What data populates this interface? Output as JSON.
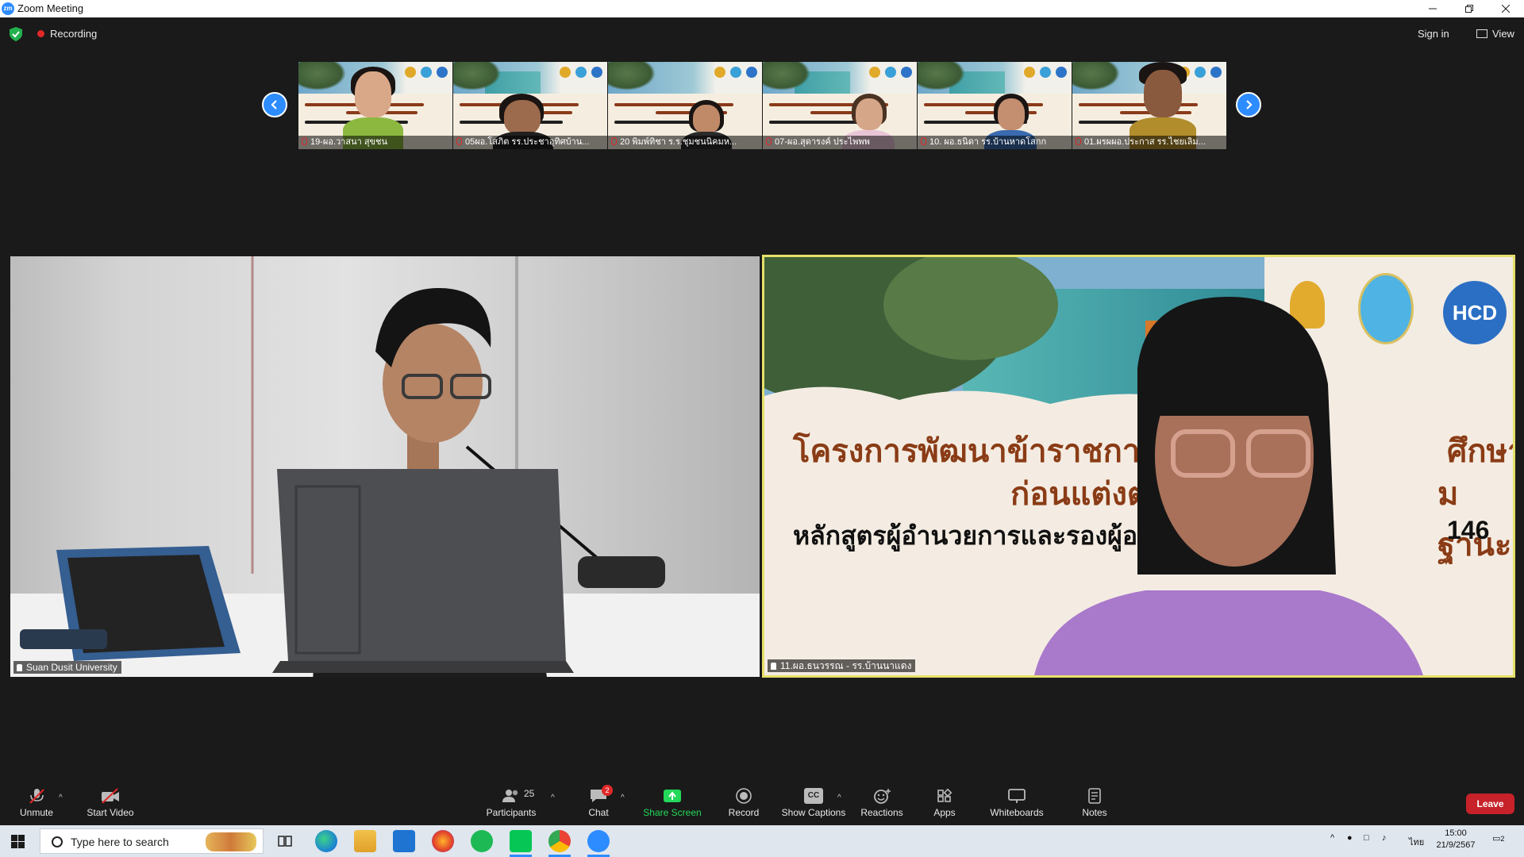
{
  "window": {
    "app_logo": "zm",
    "title": "Zoom Meeting",
    "controls": [
      "minimize-icon",
      "restore-icon",
      "close-icon"
    ]
  },
  "meeting_header": {
    "security_icon": "shield-check-icon",
    "recording_label": "Recording",
    "sign_in_label": "Sign in",
    "view_label": "View"
  },
  "thumbnails": [
    {
      "name": "19-ผอ.วาสนา สุขชน"
    },
    {
      "name": "05ผอ.โสภิต  รร.ประชาอุทิศบ้าน..."
    },
    {
      "name": "20 พิมพ์ทิชา ร.ร.ชุมชนนิคมห..."
    },
    {
      "name": "07-ผอ.สุดารงค์ ประไพพพ"
    },
    {
      "name": "10. ผอ.ธนิดา รร.บ้านหาดโสกก"
    },
    {
      "name": "01.ผรผผอ.ประกาส รร.ไชยเลิม..."
    }
  ],
  "main_videos": {
    "left": {
      "name": "Suan Dusit University"
    },
    "right": {
      "name": "11.ผอ.ธนวรรณ - รร.บ้านนาแดง",
      "slide": {
        "title_line1": "โครงการพัฒนาข้าราชการค",
        "title_line1_end": "ศึกษา",
        "title_line2": "ก่อนแต่งต",
        "title_line2_end": "มฐานะ",
        "subtitle": "หลักสูตรผู้อำนวยการและรองผู้อ",
        "subtitle_end": "146",
        "logo_hcd": "HCD"
      }
    }
  },
  "toolbar": {
    "unmute": "Unmute",
    "start_video": "Start Video",
    "participants": "Participants",
    "participants_count": "25",
    "chat": "Chat",
    "chat_badge": "2",
    "share_screen": "Share Screen",
    "record": "Record",
    "show_captions": "Show Captions",
    "captions_icon_text": "CC",
    "reactions": "Reactions",
    "apps": "Apps",
    "whiteboards": "Whiteboards",
    "notes": "Notes",
    "leave": "Leave"
  },
  "taskbar": {
    "search_placeholder": "Type here to search",
    "apps": [
      "task-view-icon",
      "edge-icon",
      "file-explorer-icon",
      "mail-icon",
      "firefox-icon",
      "spotify-icon",
      "line-icon",
      "chrome-icon",
      "zoom-icon"
    ],
    "ime": "ไทย",
    "time": "15:00",
    "date": "21/9/2567",
    "notifications_count": "2"
  },
  "colors": {
    "zoom_blue": "#2d8cff",
    "share_green": "#23d959",
    "leave_red": "#c7222a",
    "recording_red": "#e02828",
    "active_speaker_border": "#e6e06a"
  }
}
